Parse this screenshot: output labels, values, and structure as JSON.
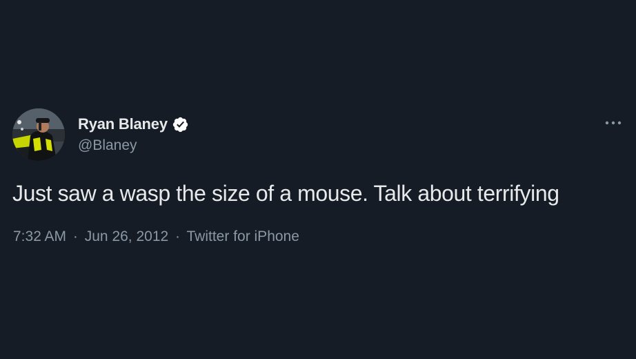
{
  "tweet": {
    "author": {
      "display_name": "Ryan Blaney",
      "handle": "@Blaney",
      "verified": true
    },
    "text": "Just saw a wasp the size of a mouse. Talk about terrifying",
    "time": "7:32 AM",
    "date": "Jun 26, 2012",
    "source": "Twitter for iPhone",
    "separator": "·"
  },
  "icons": {
    "verified": "verified-badge-icon",
    "more": "more-options-icon"
  },
  "colors": {
    "background": "#151c25",
    "primary_text": "#e7e9ea",
    "secondary_text": "#8b98a5",
    "verified_badge": "#ffffff"
  }
}
